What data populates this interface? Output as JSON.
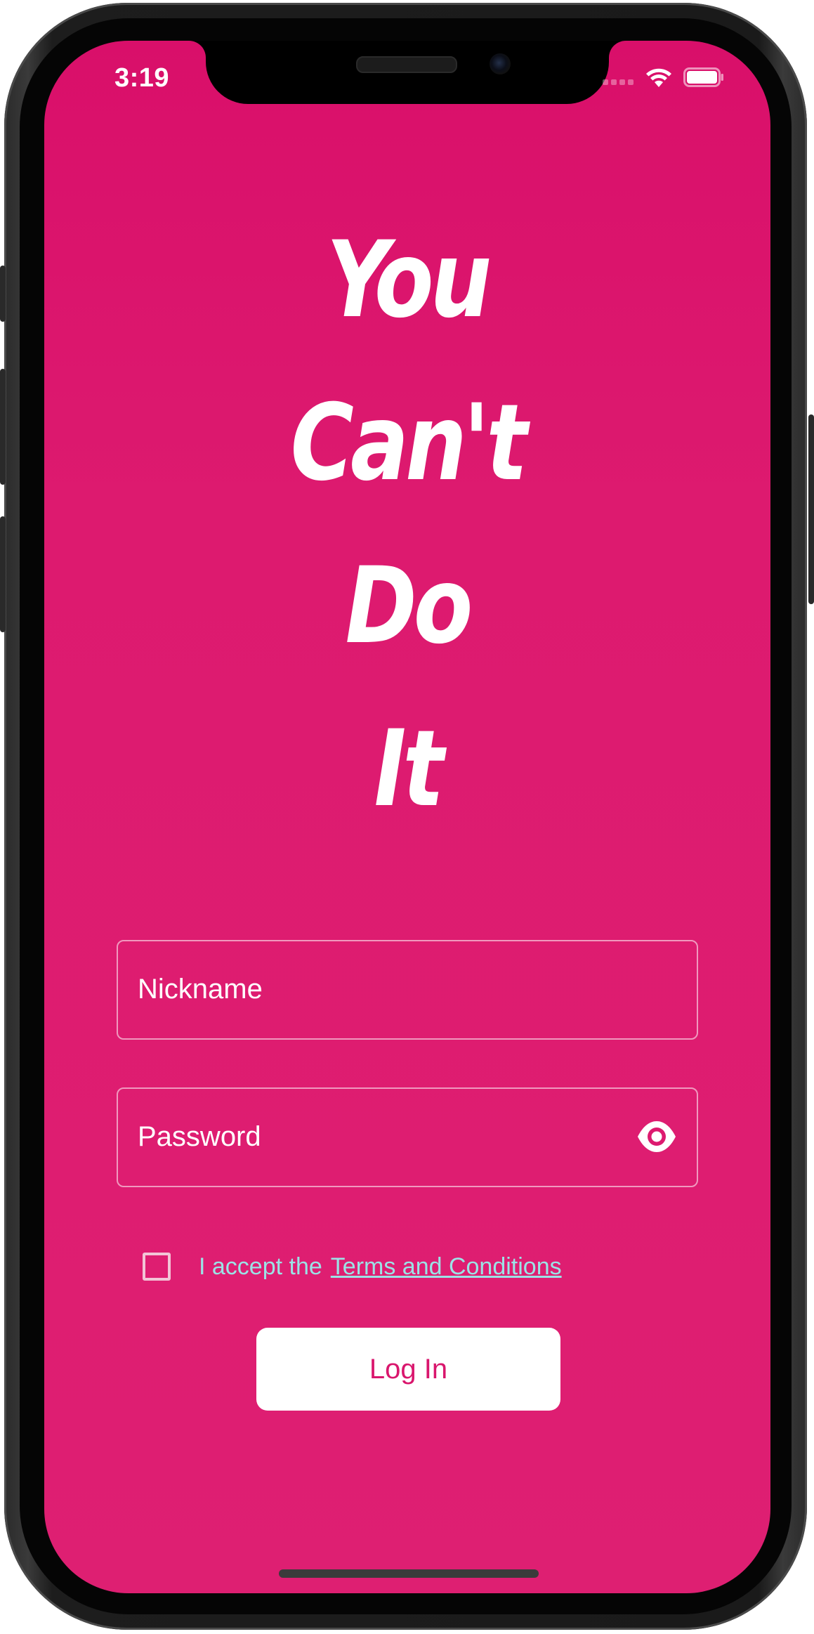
{
  "status_bar": {
    "time": "3:19",
    "wifi_icon": "wifi-icon",
    "battery_icon": "battery-icon"
  },
  "title": {
    "lines": [
      "You",
      "Can't",
      "Do",
      "It"
    ]
  },
  "form": {
    "nickname_placeholder": "Nickname",
    "password_placeholder": "Password",
    "password_toggle_icon": "eye-icon",
    "terms_prefix": "I accept the",
    "terms_link": "Terms and Conditions",
    "terms_checked": false,
    "login_label": "Log In"
  },
  "colors": {
    "background": "#dd1a6f",
    "text": "#ffffff",
    "terms_text": "#9be3e6",
    "button_bg": "#ffffff",
    "button_text": "#d9166d"
  }
}
